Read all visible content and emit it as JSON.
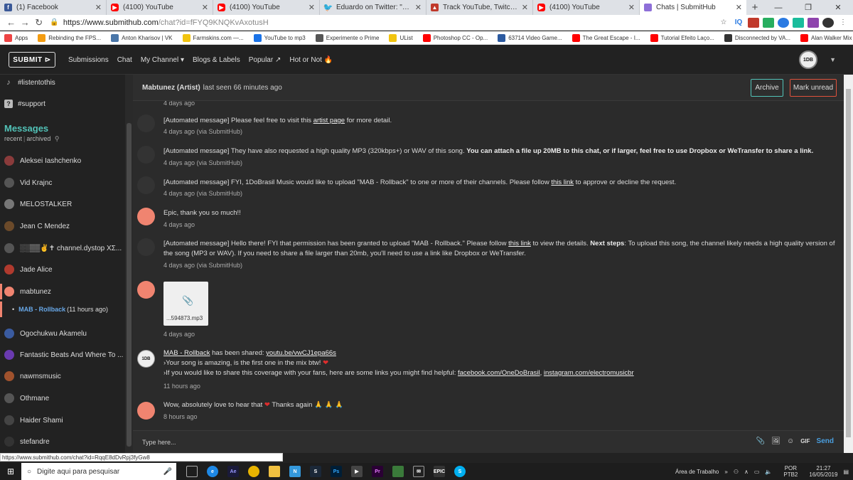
{
  "browser": {
    "tabs": [
      {
        "icon": "facebook-icon",
        "title": "(1) Facebook"
      },
      {
        "icon": "youtube-icon",
        "title": "(4100) YouTube"
      },
      {
        "icon": "youtube-icon",
        "title": "(4100) YouTube"
      },
      {
        "icon": "twitter-icon",
        "title": "Eduardo on Twitter: \"Então, por i"
      },
      {
        "icon": "tracker-icon",
        "title": "Track YouTube, Twitch, Instagra"
      },
      {
        "icon": "youtube-icon",
        "title": "(4100) YouTube"
      },
      {
        "icon": "submithub-icon",
        "title": "Chats | SubmitHub",
        "active": true
      }
    ],
    "url_host": "https://www.submithub.com",
    "url_path": "/chat?id=fFYQ9KNQKvAxotusH",
    "bookmarks": [
      {
        "label": "Apps",
        "color": "#e44"
      },
      {
        "label": "Rebinding the FPS...",
        "color": "#f39c12"
      },
      {
        "label": "Anton Kharisov | VK",
        "color": "#4a76a8"
      },
      {
        "label": "Farmskins.com —...",
        "color": "#f1c40f"
      },
      {
        "label": "YouTube to mp3",
        "color": "#1a73e8"
      },
      {
        "label": "Experimente o Prime",
        "color": "#555"
      },
      {
        "label": "UList",
        "color": "#f1c40f"
      },
      {
        "label": "Photoshop CC - Op...",
        "color": "#ff0000"
      },
      {
        "label": "63714 Video Game...",
        "color": "#2c5aa0"
      },
      {
        "label": "The Great Escape - I...",
        "color": "#ff0000"
      },
      {
        "label": "Tutorial Efeito Laço...",
        "color": "#ff0000"
      },
      {
        "label": "Disconnected by VA...",
        "color": "#333"
      },
      {
        "label": "Alan Walker Mix 20...",
        "color": "#ff0000"
      }
    ]
  },
  "header": {
    "submit_label": "SUBMIT ⊳",
    "nav": [
      "Submissions",
      "Chat",
      "My Channel ▾",
      "Blogs & Labels",
      "Popular ↗",
      "Hot or Not 🔥"
    ],
    "avatar_text": "1DB"
  },
  "sidebar": {
    "channels": [
      {
        "icon": "music-note-icon",
        "glyph": "♪",
        "label": "#listentothis"
      },
      {
        "icon": "question-icon",
        "glyph": "?",
        "label": "#support"
      }
    ],
    "messages_title": "Messages",
    "filter_recent": "recent",
    "filter_archived": "archived",
    "contacts": [
      {
        "name": "Aleksei Iashchenko",
        "color": "#8a3b3b"
      },
      {
        "name": "Vid Krajnc",
        "color": "#555"
      },
      {
        "name": "MELOSTALKER",
        "color": "#777"
      },
      {
        "name": "Jean C Mendez",
        "color": "#6b4a2a"
      },
      {
        "name": "░░▒▒✌✝ channel.dystop ΧΣ...",
        "color": "#555"
      },
      {
        "name": "Jade Alice",
        "color": "#b03a2e"
      },
      {
        "name": "mabtunez",
        "color": "#f08470",
        "selected": true
      }
    ],
    "subitem_song": "MAB - Rollback",
    "subitem_time": "(11 hours ago)",
    "contacts_after": [
      {
        "name": "Ogochukwu Akamelu",
        "color": "#3a5ba0"
      },
      {
        "name": "Fantastic Beats And Where To ...",
        "color": "#6a3ab0"
      },
      {
        "name": "nawmsmusic",
        "color": "#a0522d"
      },
      {
        "name": "Othmane",
        "color": "#555"
      },
      {
        "name": "Haider Shami",
        "color": "#444"
      },
      {
        "name": "stefandre",
        "color": "#333"
      }
    ]
  },
  "chat": {
    "contact_name": "Mabtunez (Artist)",
    "last_seen": "last seen 66 minutes ago",
    "archive_label": "Archive",
    "mark_unread_label": "Mark unread",
    "top_time": "4 days ago",
    "m1_pre": "[Automated message] Please feel free to visit this ",
    "m1_link": "artist page",
    "m1_post": " for more detail.",
    "m1_time": "4 days ago (via SubmitHub)",
    "m2_pre": "[Automated message] They have also requested a high quality MP3 (320kbps+) or WAV of this song. ",
    "m2_bold": "You can attach a file up 20MB to this chat, or if larger, feel free to use Dropbox or WeTransfer to share a link.",
    "m2_time": "4 days ago (via SubmitHub)",
    "m3_pre": "[Automated message] FYI, 1DoBrasil Music would like to upload \"MAB - Rollback\" to one or more of their channels. Please follow ",
    "m3_link": "this link",
    "m3_post": " to approve or decline the request.",
    "m3_time": "4 days ago (via SubmitHub)",
    "m4_text": "Epic, thank you so much!!",
    "m4_time": "4 days ago",
    "m5_pre": "[Automated message] Hello there! FYI that permission has been granted to upload \"MAB - Rollback.\" Please follow ",
    "m5_link": "this link",
    "m5_mid": " to view the details. ",
    "m5_bold": "Next steps",
    "m5_post": ": To upload this song, the channel likely needs a high quality version of the song (MP3 or WAV). If you need to share a file larger than 20mb, you'll need to use a link like Dropbox or WeTransfer.",
    "m5_time": "4 days ago (via SubmitHub)",
    "attach_name": "...594873.mp3",
    "m6_time": "4 days ago",
    "m7_song": "MAB - Rollback",
    "m7_shared": " has been shared: ",
    "m7_url": "youtu.be/vwCJ1epa66s",
    "m7_line2": "›Your song is amazing, is the first one in the mix btw! ",
    "m7_line3": "›If you would like to share this coverage with your fans, here are some links you might find helpful: ",
    "m7_fb": "facebook.com/OneDoBrasil",
    "m7_comma": ", ",
    "m7_ig": "instagram.com/electromusicbr",
    "m7_time": "11 hours ago",
    "m8_pre": "Wow, absolutely love to hear that ",
    "m8_post": " Thanks again 🙏 🙏 🙏",
    "m8_time": "8 hours ago",
    "composer_placeholder": "Type here...",
    "gif_label": "GIF",
    "send_label": "Send"
  },
  "status_url": "https://www.submithub.com/chat?id=RqqE8dDvRpj3fyGw8",
  "taskbar": {
    "search_placeholder": "Digite aqui para pesquisar",
    "desktop_label": "Área de Trabalho",
    "lang_top": "POR",
    "lang_bottom": "PTB2",
    "time": "21:27",
    "date": "16/05/2019"
  }
}
